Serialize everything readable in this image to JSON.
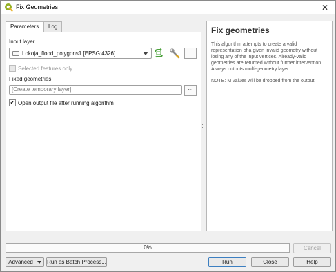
{
  "window": {
    "title": "Fix Geometries"
  },
  "tabs": [
    {
      "label": "Parameters",
      "active": true
    },
    {
      "label": "Log",
      "active": false
    }
  ],
  "params": {
    "input_layer_label": "Input layer",
    "input_layer_value": "Lokoja_flood_polygons1 [EPSG:4326]",
    "selected_only_label": "Selected features only",
    "selected_only_checked": false,
    "fixed_geometries_label": "Fixed geometries",
    "fixed_geometries_placeholder": "[Create temporary layer]",
    "open_output_label": "Open output file after running algorithm",
    "open_output_checked": true,
    "checkmark": "✔",
    "ellipsis": "..."
  },
  "help": {
    "title": "Fix geometries",
    "paragraph1": "This algorithm attempts to create a valid representation of a given invalid geometry without losing any of the input vertices. Already-valid geometries are returned without further intervention. Always outputs multi-geometry layer.",
    "paragraph2": "NOTE: M values will be dropped from the output."
  },
  "progress": {
    "text": "0%",
    "value": 0
  },
  "buttons": {
    "cancel": "Cancel",
    "advanced": "Advanced",
    "batch": "Run as Batch Process...",
    "run": "Run",
    "close": "Close",
    "help": "Help"
  },
  "icons": [
    "qgis-logo-icon",
    "close-icon",
    "layer-polygon-icon",
    "dropdown-arrow-icon",
    "iterate-icon",
    "wrench-icon",
    "checkmark-icon"
  ],
  "colors": {
    "qgis_green": "#93b023",
    "iterate_green": "#4aa03a",
    "default_border": "#3c7fc1"
  }
}
